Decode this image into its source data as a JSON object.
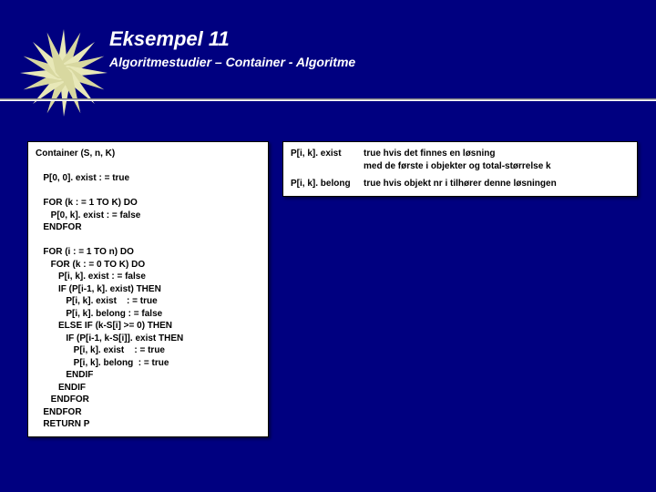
{
  "header": {
    "title": "Eksempel 11",
    "subtitle": "Algoritmestudier – Container   -   Algoritme"
  },
  "code": "Container (S, n, K)\n\n   P[0, 0]. exist : = true\n\n   FOR (k : = 1 TO K) DO\n      P[0, k]. exist : = false\n   ENDFOR\n\n   FOR (i : = 1 TO n) DO\n      FOR (k : = 0 TO K) DO\n         P[i, k]. exist : = false\n         IF (P[i-1, k]. exist) THEN\n            P[i, k]. exist    : = true\n            P[i, k]. belong : = false\n         ELSE IF (k-S[i] >= 0) THEN\n            IF (P[i-1, k-S[i]]. exist THEN\n               P[i, k]. exist    : = true\n               P[i, k]. belong  : = true\n            ENDIF\n         ENDIF\n      ENDFOR\n   ENDFOR\n   RETURN P",
  "defs": {
    "row1": {
      "term": "P[i, k]. exist",
      "desc_l1": "true hvis det finnes en løsning",
      "desc_l2": "med de første i objekter og total-størrelse k"
    },
    "row2": {
      "term": "P[i, k]. belong",
      "desc": "true hvis objekt nr i tilhører denne løsningen"
    }
  }
}
